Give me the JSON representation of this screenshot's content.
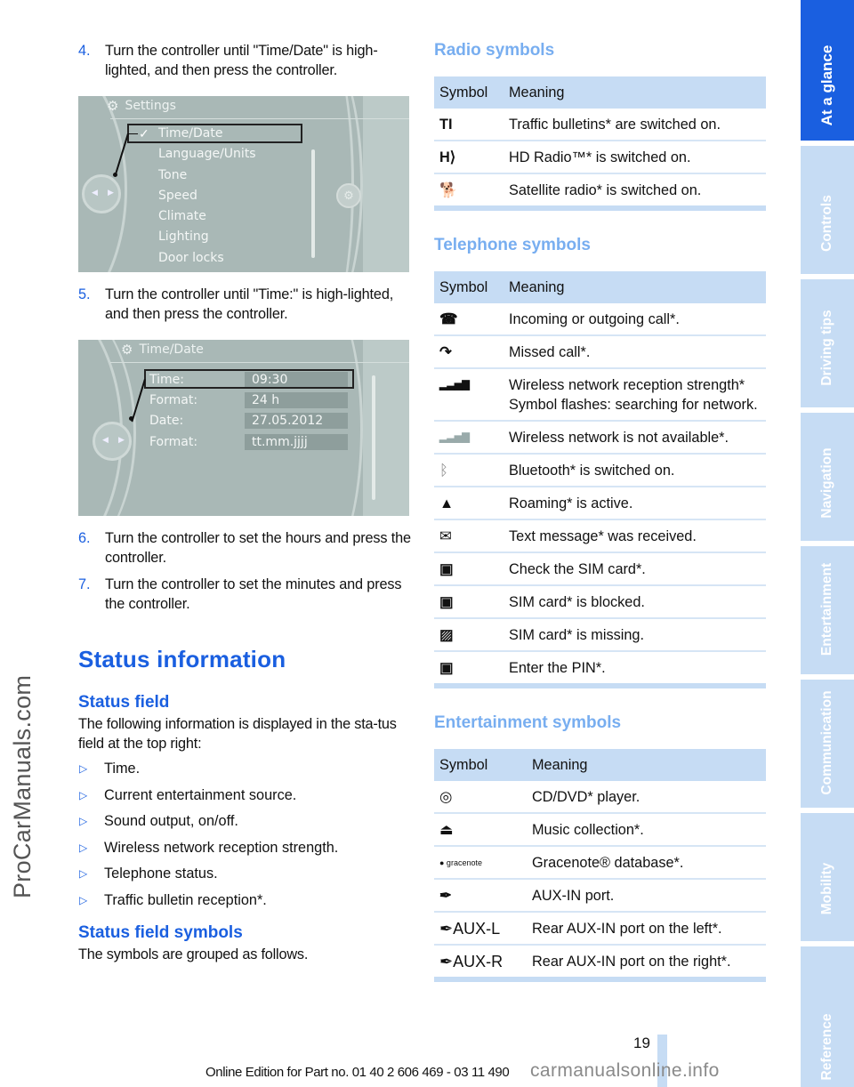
{
  "watermark_left": "ProCarManuals.com",
  "steps": [
    {
      "num": "4.",
      "text": "Turn the controller until \"Time/Date\" is high-lighted, and then press the controller."
    },
    {
      "num": "5.",
      "text": "Turn the controller until \"Time:\" is high-lighted, and then press the controller."
    },
    {
      "num": "6.",
      "text": "Turn the controller to set the hours and press the controller."
    },
    {
      "num": "7.",
      "text": "Turn the controller to set the minutes and press the controller."
    }
  ],
  "screen1": {
    "header": "Settings",
    "selected_mark": "✓",
    "items": [
      "Time/Date",
      "Language/Units",
      "Tone",
      "Speed",
      "Climate",
      "Lighting",
      "Door locks"
    ]
  },
  "screen2": {
    "header": "Time/Date",
    "fields": [
      {
        "label": "Time:",
        "value": "09:30"
      },
      {
        "label": "Format:",
        "value": "24 h"
      },
      {
        "label": "Date:",
        "value": "27.05.2012"
      },
      {
        "label": "Format:",
        "value": "tt.mm.jjjj"
      }
    ]
  },
  "status_info": {
    "title": "Status information",
    "status_field": {
      "title": "Status field",
      "intro": "The following information is displayed in the sta-tus field at the top right:",
      "bullets": [
        "Time.",
        "Current entertainment source.",
        "Sound output, on/off.",
        "Wireless network reception strength.",
        "Telephone status.",
        "Traffic bulletin reception*."
      ]
    },
    "symbols": {
      "title": "Status field symbols",
      "intro": "The symbols are grouped as follows."
    }
  },
  "tables": {
    "col_symbol": "Symbol",
    "col_meaning": "Meaning",
    "radio": {
      "title": "Radio symbols",
      "rows": [
        {
          "icon": "traffic-bulletin-icon",
          "glyph": "TI",
          "meaning": "Traffic bulletins* are switched on."
        },
        {
          "icon": "hd-radio-icon",
          "glyph": "H⟩",
          "meaning": "HD Radio™* is switched on."
        },
        {
          "icon": "satellite-radio-icon",
          "glyph": "🐕",
          "meaning": "Satellite radio* is switched on."
        }
      ]
    },
    "telephone": {
      "title": "Telephone symbols",
      "rows": [
        {
          "icon": "phone-call-icon",
          "glyph": "☎",
          "meaning": "Incoming or outgoing call*."
        },
        {
          "icon": "missed-call-icon",
          "glyph": "↷",
          "meaning": "Missed call*."
        },
        {
          "icon": "signal-strength-icon",
          "glyph": "▂▃▅▇",
          "meaning": "Wireless network reception strength* Symbol flashes: searching for network."
        },
        {
          "icon": "no-network-icon",
          "glyph": "▂▃▅▇",
          "meaning": "Wireless network is not available*."
        },
        {
          "icon": "bluetooth-icon",
          "glyph": "ᛒ",
          "meaning": "Bluetooth* is switched on."
        },
        {
          "icon": "roaming-icon",
          "glyph": "▲",
          "meaning": "Roaming* is active."
        },
        {
          "icon": "envelope-icon",
          "glyph": "✉",
          "meaning": "Text message* was received."
        },
        {
          "icon": "sim-check-icon",
          "glyph": "▣",
          "meaning": "Check the SIM card*."
        },
        {
          "icon": "sim-blocked-icon",
          "glyph": "▣",
          "meaning": "SIM card* is blocked."
        },
        {
          "icon": "sim-missing-icon",
          "glyph": "▨",
          "meaning": "SIM card* is missing."
        },
        {
          "icon": "enter-pin-icon",
          "glyph": "▣",
          "meaning": "Enter the PIN*."
        }
      ]
    },
    "entertainment": {
      "title": "Entertainment symbols",
      "rows": [
        {
          "icon": "cd-dvd-icon",
          "glyph": "◎",
          "meaning": "CD/DVD* player."
        },
        {
          "icon": "music-collection-icon",
          "glyph": "⏏",
          "meaning": "Music collection*."
        },
        {
          "icon": "gracenote-icon",
          "glyph": "● gracenote",
          "meaning": "Gracenote® database*."
        },
        {
          "icon": "aux-in-icon",
          "glyph": "✒",
          "meaning": "AUX-IN port."
        },
        {
          "icon": "aux-left-icon",
          "glyph": "✒AUX-L",
          "meaning": "Rear AUX-IN port on the left*."
        },
        {
          "icon": "aux-right-icon",
          "glyph": "✒AUX-R",
          "meaning": "Rear AUX-IN port on the right*."
        }
      ]
    }
  },
  "side_tabs": [
    {
      "label": "At a glance",
      "active": true
    },
    {
      "label": "Controls",
      "active": false
    },
    {
      "label": "Driving tips",
      "active": false
    },
    {
      "label": "Navigation",
      "active": false
    },
    {
      "label": "Entertainment",
      "active": false
    },
    {
      "label": "Communication",
      "active": false
    },
    {
      "label": "Mobility",
      "active": false
    },
    {
      "label": "Reference",
      "active": false
    }
  ],
  "footer": {
    "page_number": "19",
    "edition": "Online Edition for Part no. 01 40 2 606 469 - 03 11 490",
    "watermark": "carmanualsonline.info"
  },
  "colors": {
    "accent": "#1a5fe0",
    "light_accent": "#78aef0",
    "table_header": "#c6dcf4"
  }
}
